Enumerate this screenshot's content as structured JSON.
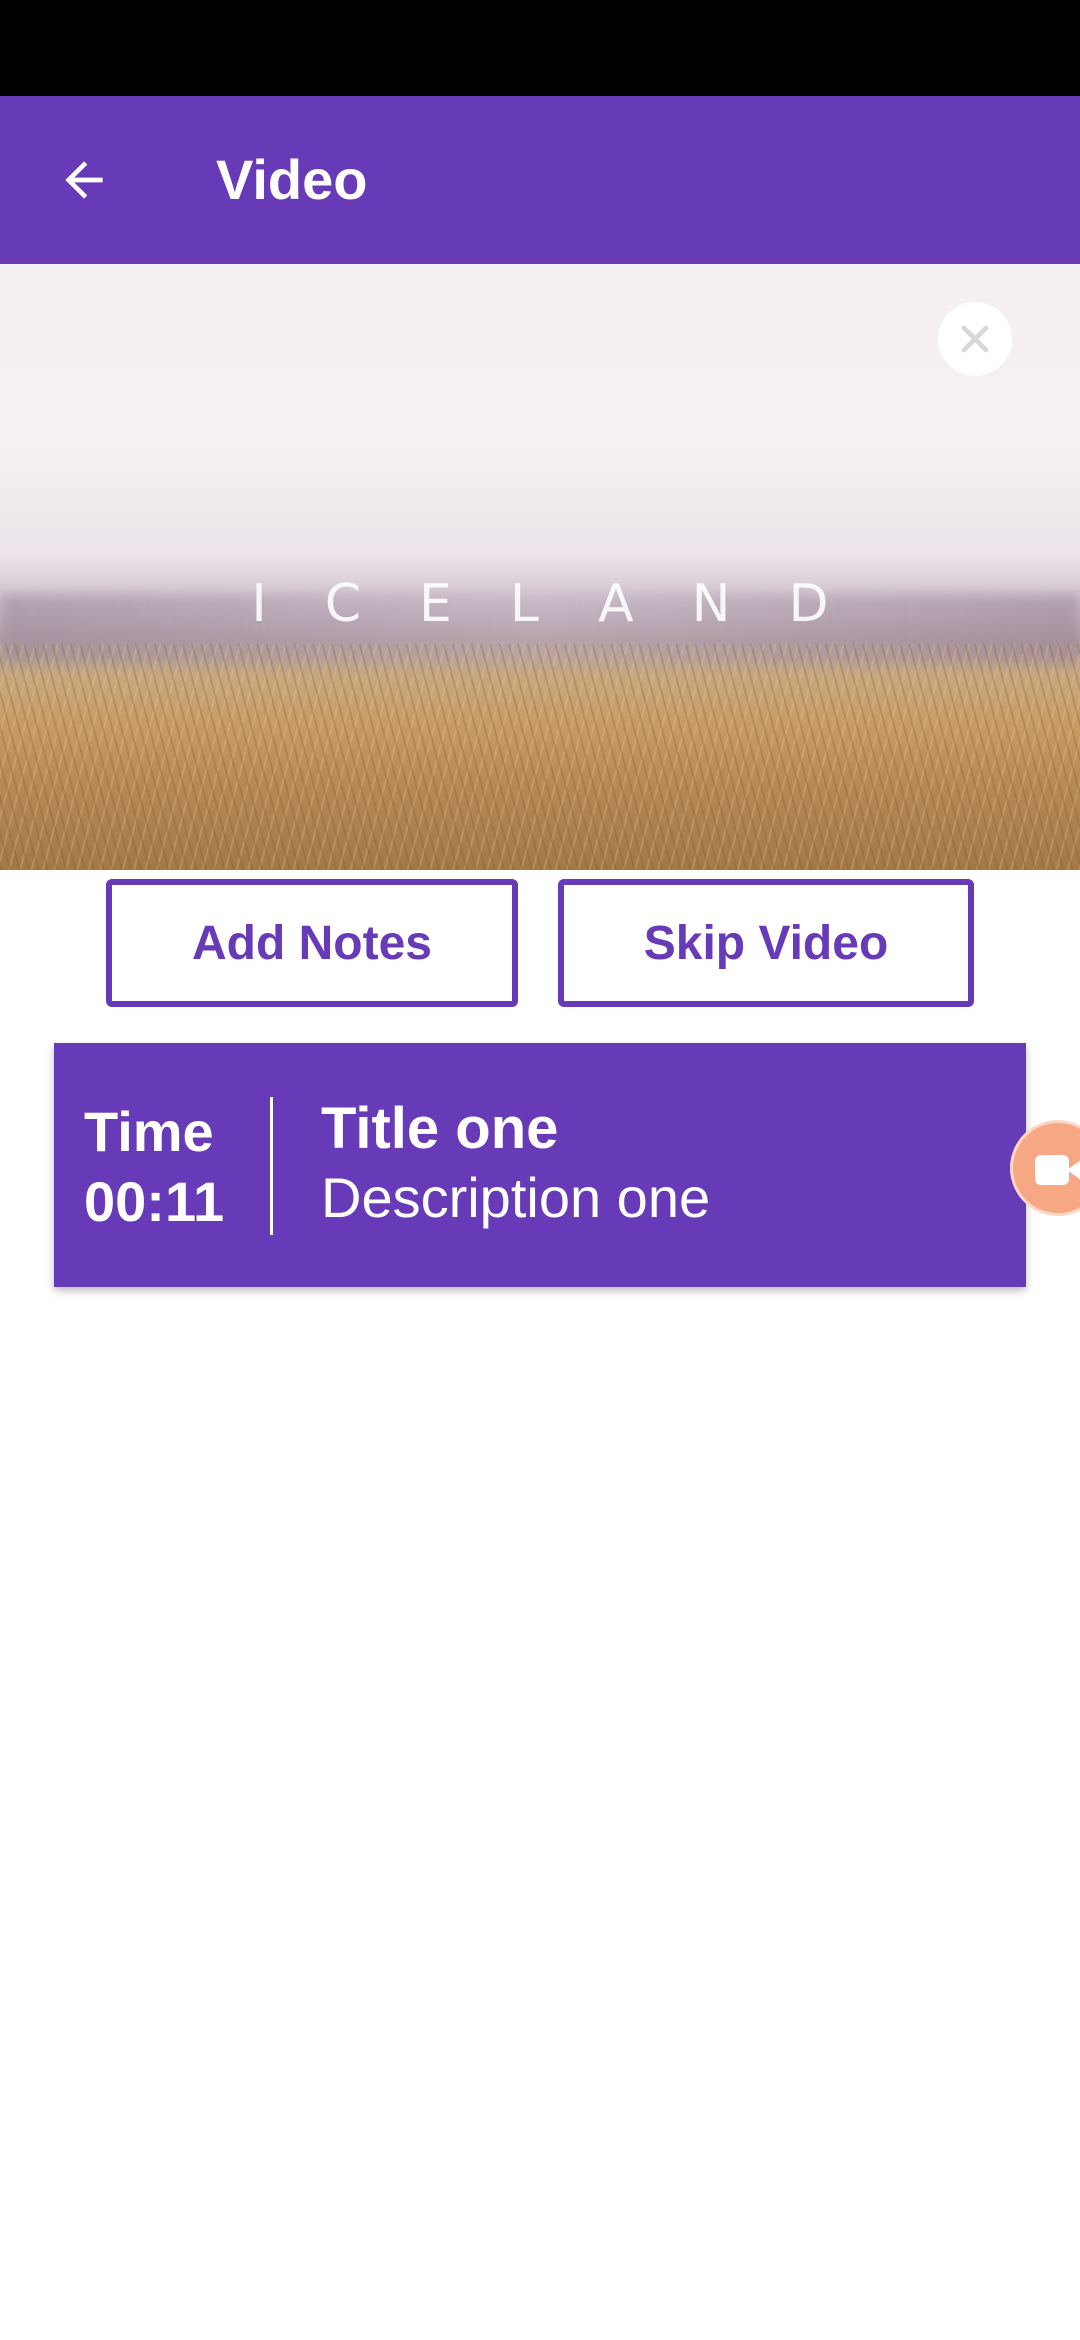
{
  "app_bar": {
    "title": "Video",
    "back_icon": "arrow-left-icon",
    "color": "#673ab7"
  },
  "video": {
    "caption": "ICELAND",
    "close_icon": "close-icon"
  },
  "actions": {
    "add_notes_label": "Add Notes",
    "skip_video_label": "Skip Video"
  },
  "notes": [
    {
      "time_label": "Time",
      "time_value": "00:11",
      "title": "Title one",
      "description": "Description one"
    }
  ],
  "floating_button": {
    "icon": "video-camera-icon",
    "color": "#f5a883"
  }
}
